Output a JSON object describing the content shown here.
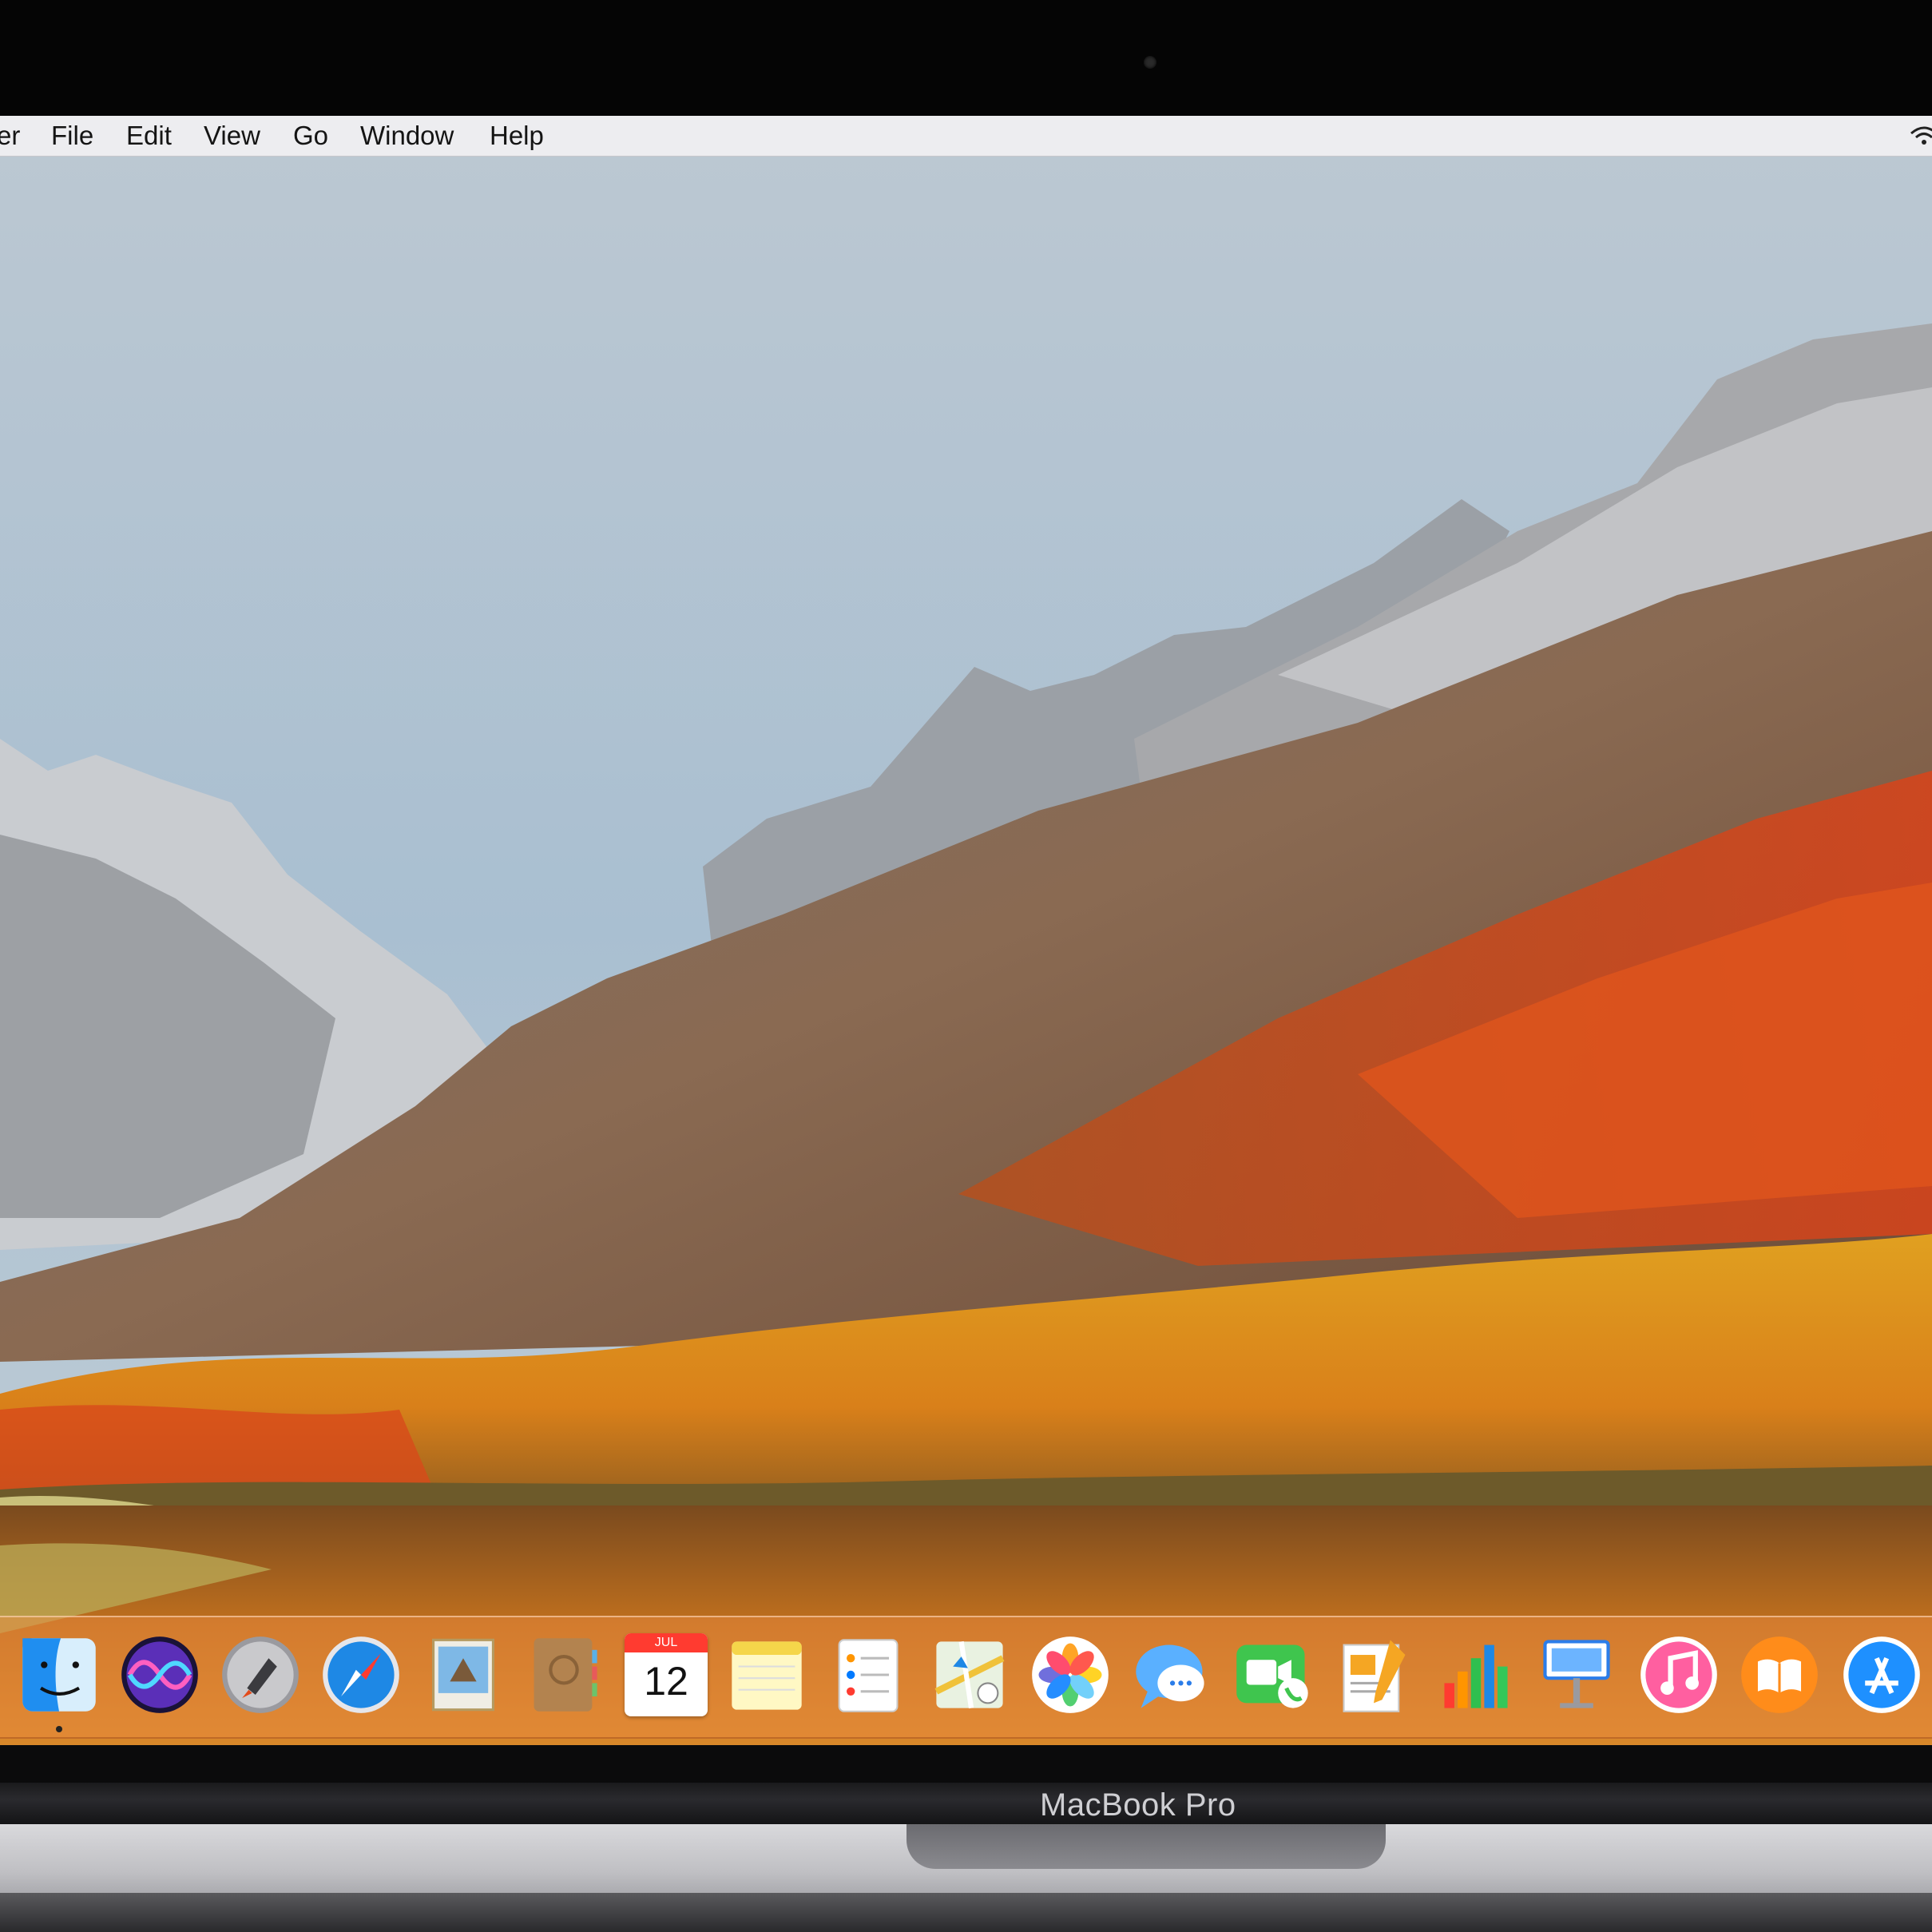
{
  "menubar": {
    "app_fragment": "er",
    "items": [
      "File",
      "Edit",
      "View",
      "Go",
      "Window",
      "Help"
    ],
    "status_icon": "wifi-icon"
  },
  "dock": {
    "apps": [
      {
        "name": "finder-icon",
        "color": "#3aa0f0"
      },
      {
        "name": "siri-icon",
        "color": "#6b3cc9"
      },
      {
        "name": "launchpad-icon",
        "color": "#8e8e93"
      },
      {
        "name": "safari-icon",
        "color": "#1e88e5"
      },
      {
        "name": "mail-icon",
        "color": "#6aa9e0"
      },
      {
        "name": "contacts-icon",
        "color": "#b08050"
      },
      {
        "name": "calendar-icon",
        "color": "#ffffff"
      },
      {
        "name": "notes-icon",
        "color": "#fff6b0"
      },
      {
        "name": "reminders-icon",
        "color": "#ffffff"
      },
      {
        "name": "maps-icon",
        "color": "#8cc36b"
      },
      {
        "name": "photos-icon",
        "color": "#ffffff"
      },
      {
        "name": "messages-icon",
        "color": "#4aa8ff"
      },
      {
        "name": "facetime-icon",
        "color": "#3fc54e"
      },
      {
        "name": "pages-icon",
        "color": "#f5a623"
      },
      {
        "name": "numbers-icon",
        "color": "#2fbf4f"
      },
      {
        "name": "keynote-icon",
        "color": "#2b7de9"
      },
      {
        "name": "itunes-icon",
        "color": "#ff3e7f"
      },
      {
        "name": "ibooks-icon",
        "color": "#ff8c1a"
      },
      {
        "name": "app-store-icon",
        "color": "#1e90ff"
      }
    ],
    "calendar": {
      "month": "JUL",
      "day": "12"
    }
  },
  "device": {
    "brand": "MacBook Pro"
  }
}
